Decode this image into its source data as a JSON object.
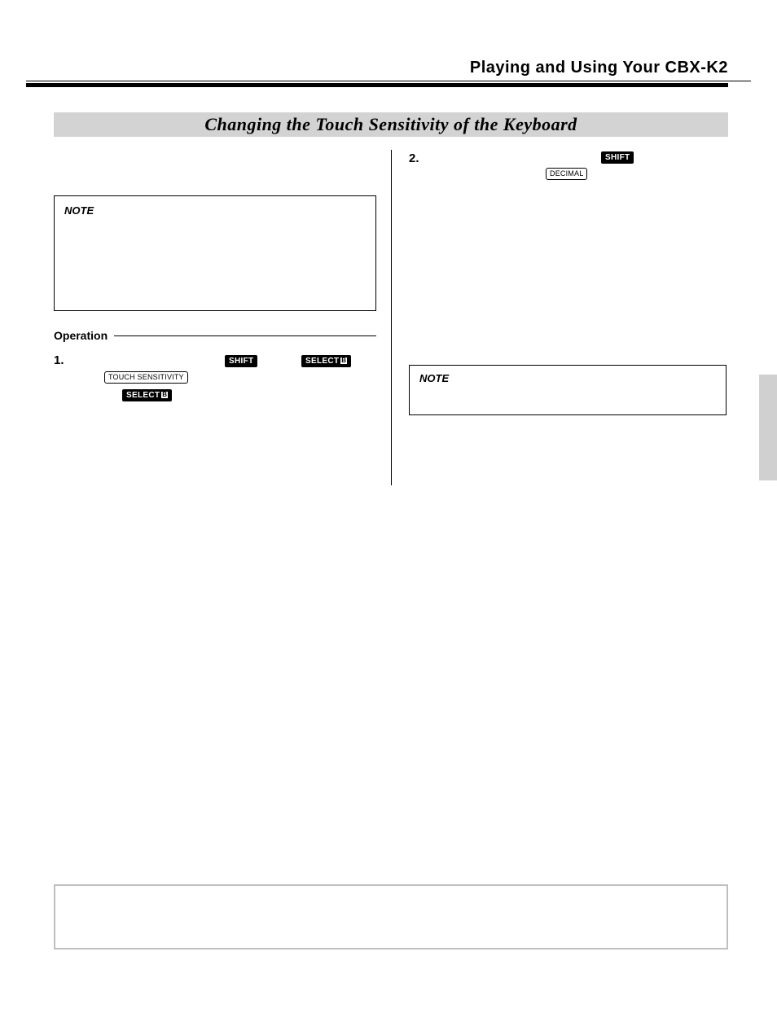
{
  "header": {
    "running": "Playing and Using Your CBX-K2"
  },
  "section": {
    "title": "Changing the Touch Sensitivity of the Keyboard"
  },
  "left": {
    "note_label": "NOTE",
    "operation_label": "Operation",
    "step1_num": "1.",
    "keys": {
      "shift": "SHIFT",
      "select_b": "SELECT",
      "select_b_box": "B",
      "touch_sens": "TOUCH SENSITIVITY"
    }
  },
  "right": {
    "step2_num": "2.",
    "keys": {
      "shift": "SHIFT",
      "decimal": "DECIMAL"
    },
    "note_label": "NOTE"
  }
}
